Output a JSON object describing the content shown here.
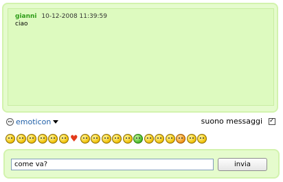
{
  "chat": {
    "messages": [
      {
        "user": "gianni",
        "timestamp": "10-12-2008 11:39:59",
        "text": "ciao"
      }
    ]
  },
  "toolbar": {
    "emoticon_label": "emoticon",
    "sound_label": "suono messaggi",
    "sound_enabled": true
  },
  "emoticons": [
    "smile-emoticon",
    "grin-emoticon",
    "sad-emoticon",
    "shocked-emoticon",
    "laugh-emoticon",
    "wink-emoticon",
    "heart-emoticon",
    "surprised-emoticon",
    "cool-emoticon",
    "confused-emoticon",
    "blush-emoticon",
    "neutral-emoticon",
    "sick-emoticon",
    "bigsmile-emoticon",
    "tongue-emoticon",
    "sleepy-emoticon",
    "angry-emoticon",
    "cry-emoticon",
    "laughing-emoticon"
  ],
  "composer": {
    "input_value": "come va?",
    "send_label": "invia"
  }
}
